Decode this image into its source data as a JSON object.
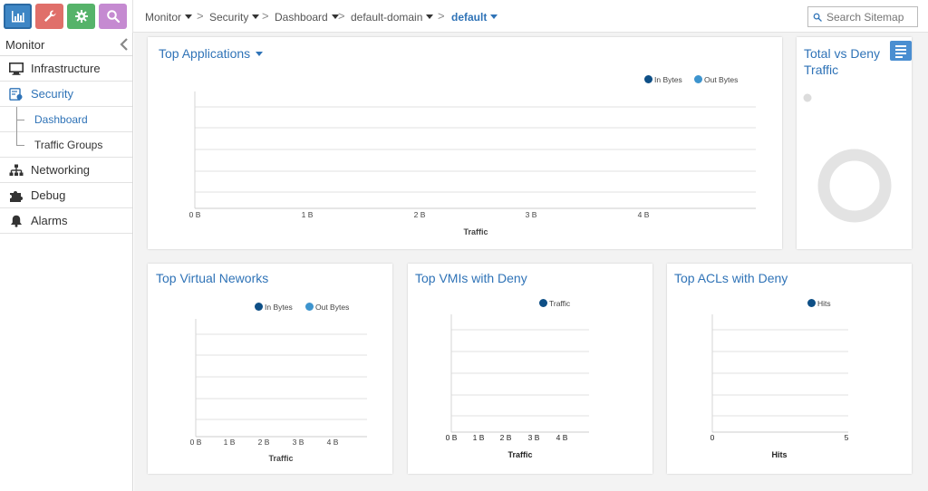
{
  "top_tabs": [
    {
      "name": "monitor",
      "icon": "bar-chart-icon",
      "color": "#3e86c5"
    },
    {
      "name": "configure",
      "icon": "wrench-icon",
      "color": "#e06f6a"
    },
    {
      "name": "settings",
      "icon": "gear-icon",
      "color": "#56b36a"
    },
    {
      "name": "query",
      "icon": "search-icon",
      "color": "#c58ad1"
    }
  ],
  "breadcrumb": {
    "items": [
      "Monitor",
      "Security",
      "Dashboard",
      "default-domain",
      "default"
    ],
    "separator": ">"
  },
  "search": {
    "placeholder": "Search Sitemap"
  },
  "sidebar": {
    "header": "Monitor",
    "items": [
      {
        "label": "Infrastructure",
        "icon": "monitor-icon"
      },
      {
        "label": "Security",
        "icon": "shield-icon",
        "selected": true
      },
      {
        "label": "Dashboard",
        "sub": true,
        "selected": true
      },
      {
        "label": "Traffic Groups",
        "sub": true
      },
      {
        "label": "Networking",
        "icon": "network-icon"
      },
      {
        "label": "Debug",
        "icon": "puzzle-icon"
      },
      {
        "label": "Alarms",
        "icon": "bell-icon"
      }
    ]
  },
  "colors": {
    "accent": "#2f73b7",
    "in_bytes": "#0e4f86",
    "out_bytes": "#3d94ce"
  },
  "panels": {
    "top_apps": {
      "title": "Top Applications",
      "legend": [
        "In Bytes",
        "Out Bytes"
      ],
      "x_ticks": [
        "0 B",
        "1 B",
        "2 B",
        "3 B",
        "4 B"
      ],
      "xlabel": "Traffic"
    },
    "total_deny": {
      "title": "Total vs Deny Traffic"
    },
    "top_vn": {
      "title": "Top Virtual Neworks",
      "legend": [
        "In Bytes",
        "Out Bytes"
      ],
      "x_ticks": [
        "0 B",
        "1 B",
        "2 B",
        "3 B",
        "4 B"
      ],
      "xlabel": "Traffic"
    },
    "top_vmis": {
      "title": "Top VMIs with Deny",
      "legend": [
        "Traffic"
      ],
      "x_ticks": [
        "0 B",
        "1 B",
        "2 B",
        "3 B",
        "4 B"
      ],
      "xlabel": "Traffic"
    },
    "top_acls": {
      "title": "Top ACLs with Deny",
      "legend": [
        "Hits"
      ],
      "x_ticks": [
        "0",
        "5"
      ],
      "xlabel": "Hits"
    }
  }
}
